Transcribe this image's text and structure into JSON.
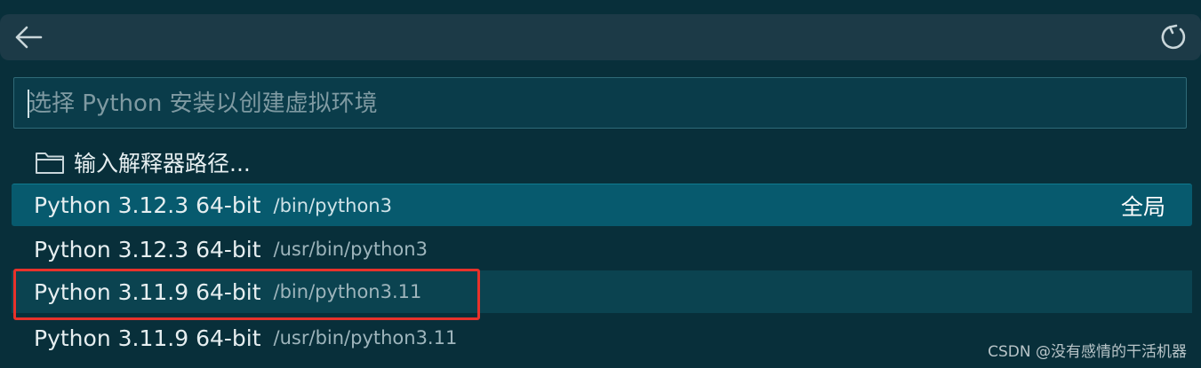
{
  "header": {
    "back_icon": "arrow-left-icon",
    "refresh_icon": "refresh-icon"
  },
  "search": {
    "placeholder": "选择 Python 安装以创建虚拟环境",
    "value": ""
  },
  "manual_entry": {
    "icon": "folder-icon",
    "label": "输入解释器路径..."
  },
  "interpreters": [
    {
      "name": "Python 3.12.3 64-bit",
      "path": "/bin/python3",
      "badge": "全局"
    },
    {
      "name": "Python 3.12.3 64-bit",
      "path": "/usr/bin/python3",
      "badge": ""
    },
    {
      "name": "Python 3.11.9 64-bit",
      "path": "/bin/python3.11",
      "badge": ""
    },
    {
      "name": "Python 3.11.9 64-bit",
      "path": "/usr/bin/python3.11",
      "badge": ""
    }
  ],
  "annotation": {
    "highlight_color": "#e8322b",
    "highlighted_item": 2
  },
  "watermark": "CSDN @没有感情的干活机器",
  "colors": {
    "background": "#082f3a",
    "selected_row": "#075a6e",
    "hover_row": "#0b4350",
    "titlebar": "#1c3a47"
  }
}
